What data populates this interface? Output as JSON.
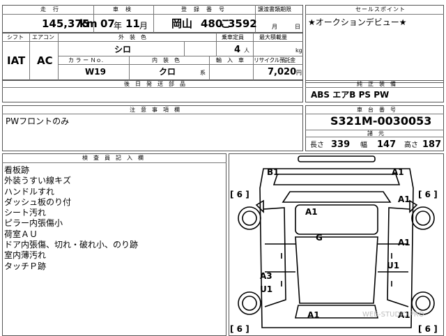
{
  "header_row": {
    "mileage_label": "走　行",
    "inspection_label": "車　検",
    "registration_label": "登　録　番　号",
    "transfer_deadline_label": "譲渡書類期限",
    "sales_point_label": "セールスポイント"
  },
  "values_row": {
    "mileage": "145,375",
    "mileage_unit": "km",
    "inspection_year": "07",
    "inspection_year_unit": "年",
    "inspection_month": "11",
    "inspection_month_unit": "月",
    "plate_region": "岡山",
    "plate_number": "480",
    "plate_kana": "こ",
    "plate_serial": "3592",
    "deadline_month_unit": "月",
    "deadline_day_unit": "日",
    "sales_point": "★オークションデビュー★"
  },
  "spec_labels": {
    "shift": "シフト",
    "aircon": "エアコン",
    "exterior_color": "外　装　色",
    "capacity": "乗車定員",
    "max_load": "最大積載量",
    "color_no": "カ ラ ー Ｎｏ.",
    "interior_color": "内　装　色",
    "import": "輸　入　車",
    "recycle": "リサイクル預託金"
  },
  "spec_values": {
    "shift": "IAT",
    "aircon": "AC",
    "exterior_color": "シロ",
    "capacity": "4",
    "capacity_unit": "人",
    "max_load_unit": "kg",
    "color_no": "W19",
    "interior_color": "クロ",
    "interior_color_unit": "系",
    "recycle": "7,020",
    "recycle_unit": "円"
  },
  "misc": {
    "post_docs_label": "後　日　発　送　部　品",
    "equipment_label": "純　正　装　備",
    "equipment": "ABS エアB PS PW",
    "notes_label": "注　意　事　項　欄",
    "notes": "PWフロントのみ",
    "chassis_label": "車　台　番　号",
    "chassis_number": "S321M-0030053",
    "dims_label": "諸　元",
    "length_label": "長さ",
    "length": "339",
    "width_label": "幅",
    "width": "147",
    "height_label": "高さ",
    "height": "187"
  },
  "inspector": {
    "label": "検　査　員　記　入　欄",
    "lines": [
      "看板跡",
      "外装うすい線キズ",
      "ハンドルすれ",
      "ダッシュ板のり付",
      "シート汚れ",
      "ピラー内張傷小",
      "荷室ＡＵ",
      "ドア内張傷、切れ・破れ小、のり跡",
      "室内薄汚れ",
      "タッチＰ跡"
    ]
  },
  "diagram": {
    "tire_depth_left_front": "[ 6 ]",
    "tire_depth_right_front": "[ 6 ]",
    "tire_depth_left_rear": "[ 6 ]",
    "tire_depth_right_rear": "[ 6 ]",
    "marks": {
      "front_left": "B1",
      "front_right": "A1",
      "right_front_fender": "A1",
      "bonnet": "A1",
      "roof": "G",
      "right_rear_door": "A1",
      "right_rear_quarter": "U1",
      "left_rear_door_a": "A3",
      "left_rear_door_u": "U1",
      "rear": "A1",
      "rear_right": "A1"
    },
    "watermark": "WEB-STUDIO.PRO"
  }
}
